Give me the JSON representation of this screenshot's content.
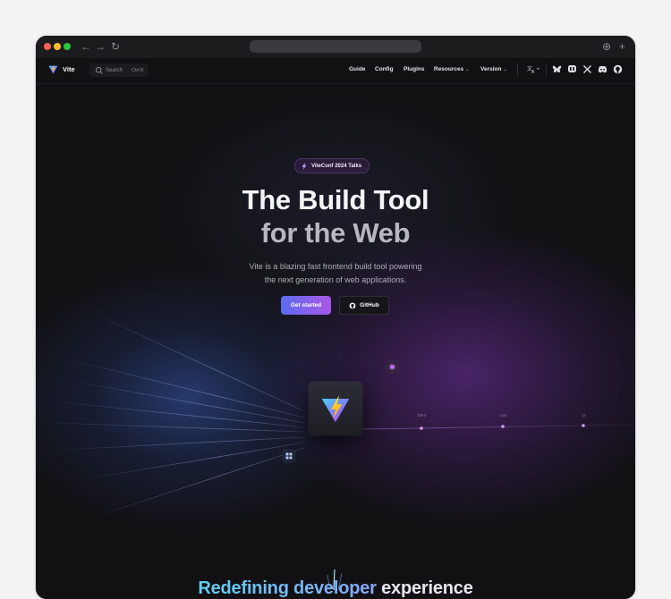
{
  "browser": {
    "nav_back": "←",
    "nav_forward": "→",
    "nav_reload": "↻",
    "action_download": "⊕",
    "action_new_tab": "+"
  },
  "site": {
    "logo_text": "Vite",
    "search": {
      "label": "Search",
      "shortcut": "Ctrl K"
    },
    "nav": [
      {
        "label": "Guide"
      },
      {
        "label": "Config"
      },
      {
        "label": "Plugins"
      },
      {
        "label": "Resources",
        "dropdown": true
      },
      {
        "label": "Version",
        "dropdown": true
      }
    ],
    "translate_icon": "translate-icon",
    "social_icons": [
      "bluesky-icon",
      "mastodon-icon",
      "x-icon",
      "discord-icon",
      "github-icon"
    ]
  },
  "hero": {
    "badge": "ViteConf 2024 Talks",
    "title_line1": "The Build Tool",
    "title_line2": "for the Web",
    "subtitle_line1": "Vite is a blazing fast frontend build tool powering",
    "subtitle_line2": "the next generation of web applications.",
    "primary_button": "Get started",
    "secondary_button": "GitHub"
  },
  "diagram": {
    "output_labels": [
      ".html",
      ".css",
      ".js"
    ]
  },
  "next_section": {
    "title_gradient": "Redefining developer",
    "title_plain": "experience"
  },
  "colors": {
    "background": "#111114",
    "accent_blue": "#5b6cf0",
    "accent_purple": "#a957e8",
    "logo_yellow": "#ffc517"
  }
}
